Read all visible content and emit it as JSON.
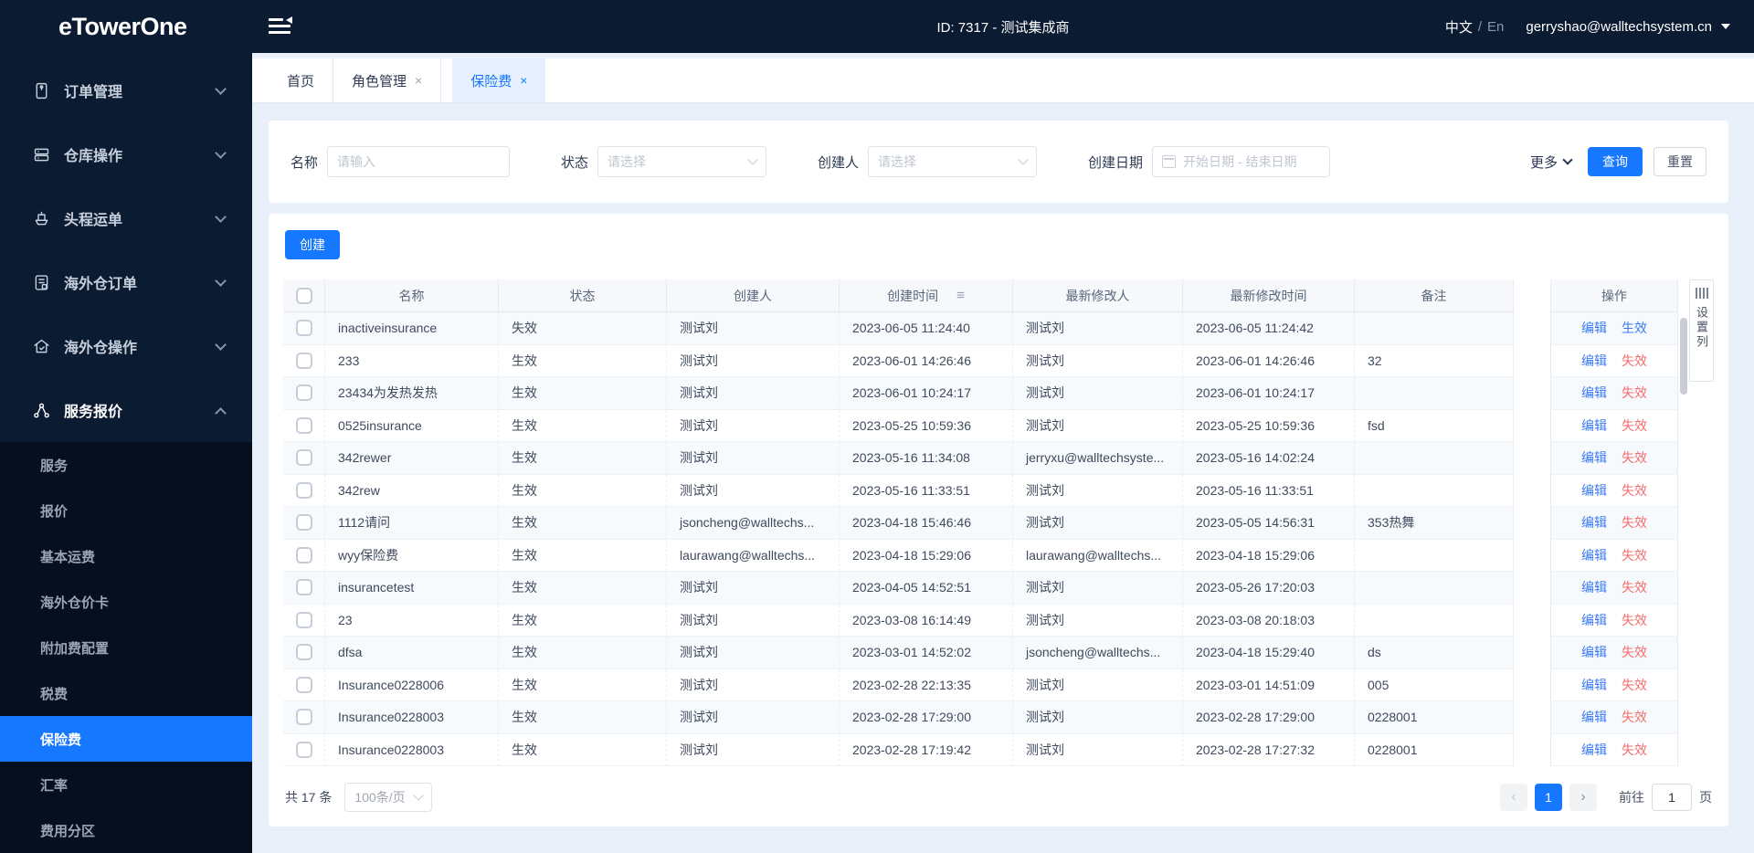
{
  "colors": {
    "accent": "#1677ff",
    "danger": "#f56c6c",
    "topbar_bg": "#0b1b32",
    "submenu_bg": "#060f1d"
  },
  "topbar": {
    "logo": "eTowerOne",
    "title": "ID: 7317 - 测试集成商",
    "lang_zh": "中文",
    "lang_sep": "/",
    "lang_en": "En",
    "user_email": "gerryshao@walltechsystem.cn"
  },
  "sidebar": {
    "items": [
      {
        "label": "订单管理",
        "icon": "order-icon",
        "expanded": false
      },
      {
        "label": "仓库操作",
        "icon": "warehouse-icon",
        "expanded": false
      },
      {
        "label": "头程运单",
        "icon": "ship-icon",
        "expanded": false
      },
      {
        "label": "海外仓订单",
        "icon": "overseas-order-icon",
        "expanded": false
      },
      {
        "label": "海外仓操作",
        "icon": "overseas-ops-icon",
        "expanded": false
      },
      {
        "label": "服务报价",
        "icon": "service-quote-icon",
        "expanded": true
      }
    ],
    "submenu": [
      "服务",
      "报价",
      "基本运费",
      "海外仓价卡",
      "附加费配置",
      "税费",
      "保险费",
      "汇率",
      "费用分区"
    ],
    "active_submenu": "保险费"
  },
  "tabs": [
    {
      "label": "首页",
      "closable": false,
      "active": false
    },
    {
      "label": "角色管理",
      "closable": true,
      "active": false
    },
    {
      "label": "保险费",
      "closable": true,
      "active": true
    }
  ],
  "filters": {
    "name_label": "名称",
    "name_placeholder": "请输入",
    "status_label": "状态",
    "status_placeholder": "请选择",
    "creator_label": "创建人",
    "creator_placeholder": "请选择",
    "date_label": "创建日期",
    "date_placeholder": "开始日期 - 结束日期",
    "more_label": "更多",
    "search_label": "查询",
    "reset_label": "重置"
  },
  "toolbar": {
    "create_label": "创建"
  },
  "table": {
    "columns": [
      "名称",
      "状态",
      "创建人",
      "创建时间",
      "最新修改人",
      "最新修改时间",
      "备注"
    ],
    "sort_icon_column": "创建时间",
    "action_header": "操作",
    "edit_label": "编辑",
    "rows": [
      {
        "name": "inactiveinsurance",
        "status": "失效",
        "creator": "测试刘",
        "created": "2023-06-05 11:24:40",
        "modifier": "测试刘",
        "modified": "2023-06-05 11:24:42",
        "remark": "",
        "action2": "生效"
      },
      {
        "name": "233",
        "status": "生效",
        "creator": "测试刘",
        "created": "2023-06-01 14:26:46",
        "modifier": "测试刘",
        "modified": "2023-06-01 14:26:46",
        "remark": "32",
        "action2": "失效"
      },
      {
        "name": "23434为发热发热",
        "status": "生效",
        "creator": "测试刘",
        "created": "2023-06-01 10:24:17",
        "modifier": "测试刘",
        "modified": "2023-06-01 10:24:17",
        "remark": "",
        "action2": "失效"
      },
      {
        "name": "0525insurance",
        "status": "生效",
        "creator": "测试刘",
        "created": "2023-05-25 10:59:36",
        "modifier": "测试刘",
        "modified": "2023-05-25 10:59:36",
        "remark": "fsd",
        "action2": "失效"
      },
      {
        "name": "342rewer",
        "status": "生效",
        "creator": "测试刘",
        "created": "2023-05-16 11:34:08",
        "modifier": "jerryxu@walltechsyste...",
        "modified": "2023-05-16 14:02:24",
        "remark": "",
        "action2": "失效"
      },
      {
        "name": "342rew",
        "status": "生效",
        "creator": "测试刘",
        "created": "2023-05-16 11:33:51",
        "modifier": "测试刘",
        "modified": "2023-05-16 11:33:51",
        "remark": "",
        "action2": "失效"
      },
      {
        "name": "1112请问",
        "status": "生效",
        "creator": "jsoncheng@walltechs...",
        "created": "2023-04-18 15:46:46",
        "modifier": "测试刘",
        "modified": "2023-05-05 14:56:31",
        "remark": "353热舞",
        "action2": "失效"
      },
      {
        "name": "wyy保险费",
        "status": "生效",
        "creator": "laurawang@walltechs...",
        "created": "2023-04-18 15:29:06",
        "modifier": "laurawang@walltechs...",
        "modified": "2023-04-18 15:29:06",
        "remark": "",
        "action2": "失效"
      },
      {
        "name": "insurancetest",
        "status": "生效",
        "creator": "测试刘",
        "created": "2023-04-05 14:52:51",
        "modifier": "测试刘",
        "modified": "2023-05-26 17:20:03",
        "remark": "",
        "action2": "失效"
      },
      {
        "name": "23",
        "status": "生效",
        "creator": "测试刘",
        "created": "2023-03-08 16:14:49",
        "modifier": "测试刘",
        "modified": "2023-03-08 20:18:03",
        "remark": "",
        "action2": "失效"
      },
      {
        "name": "dfsa",
        "status": "生效",
        "creator": "测试刘",
        "created": "2023-03-01 14:52:02",
        "modifier": "jsoncheng@walltechs...",
        "modified": "2023-04-18 15:29:40",
        "remark": "ds",
        "action2": "失效"
      },
      {
        "name": "Insurance0228006",
        "status": "生效",
        "creator": "测试刘",
        "created": "2023-02-28 22:13:35",
        "modifier": "测试刘",
        "modified": "2023-03-01 14:51:09",
        "remark": "005",
        "action2": "失效"
      },
      {
        "name": "Insurance0228003",
        "status": "生效",
        "creator": "测试刘",
        "created": "2023-02-28 17:29:00",
        "modifier": "测试刘",
        "modified": "2023-02-28 17:29:00",
        "remark": "0228001",
        "action2": "失效"
      },
      {
        "name": "Insurance0228003",
        "status": "生效",
        "creator": "测试刘",
        "created": "2023-02-28 17:19:42",
        "modifier": "测试刘",
        "modified": "2023-02-28 17:27:32",
        "remark": "0228001",
        "action2": "失效"
      }
    ]
  },
  "settings_panel": {
    "label": "设置列"
  },
  "footer": {
    "total_label": "共 17 条",
    "page_size_label": "100条/页",
    "current_page": "1",
    "goto_label": "前往",
    "goto_value": "1",
    "page_unit": "页"
  },
  "icons": {
    "close": "×",
    "sort": "≡",
    "prev": "‹",
    "next": "›"
  }
}
